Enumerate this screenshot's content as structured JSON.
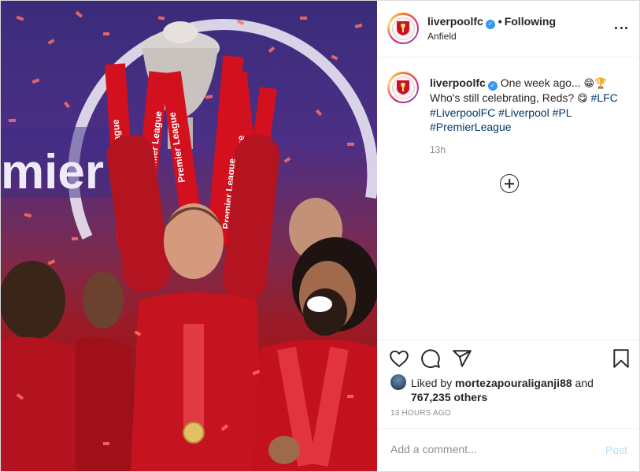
{
  "header": {
    "username": "liverpoolfc",
    "separator": "•",
    "follow_status": "Following",
    "location": "Anfield"
  },
  "caption": {
    "username": "liverpoolfc",
    "text_line1": "One week ago...",
    "emoji1": "😁",
    "emoji2": "🏆",
    "text_line2": "Who's still celebrating, Reds?",
    "emoji3": "😋",
    "hashtags": [
      "#LFC",
      "#LiverpoolFC",
      "#Liverpool",
      "#PL",
      "#PremierLeague"
    ],
    "age": "13h"
  },
  "likes": {
    "prefix": "Liked by",
    "liker": "mortezapouraliganji88",
    "and": "and",
    "others": "767,235 others"
  },
  "timestamp": "13 HOURS AGO",
  "comment": {
    "placeholder": "Add a comment...",
    "post_label": "Post"
  },
  "photo": {
    "ribbon_text": "Premier League",
    "banner_text": "mier"
  },
  "icons": {
    "like": "heart-icon",
    "comment": "comment-icon",
    "share": "share-icon",
    "save": "bookmark-icon",
    "more": "more-options-icon",
    "load_more": "plus-circle-icon"
  },
  "colors": {
    "verified": "#3897f0",
    "hashtag": "#00376b",
    "post_disabled": "#b2dffc",
    "muted": "#8e8e8e"
  }
}
